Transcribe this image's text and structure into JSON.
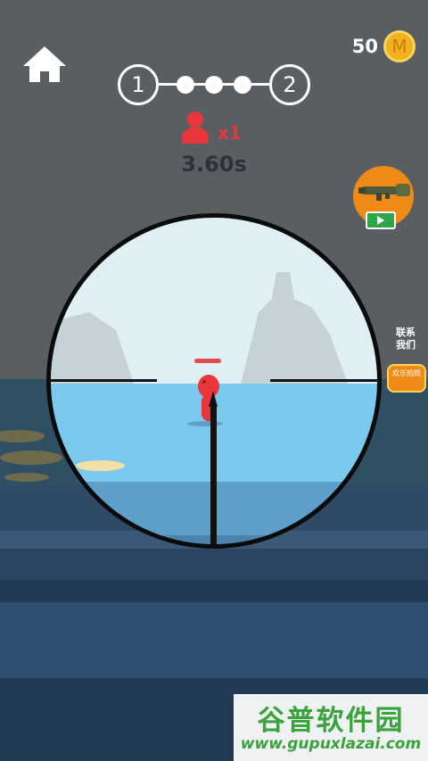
{
  "hud": {
    "coins": "50",
    "coin_symbol": "M",
    "stage_from": "1",
    "stage_to": "2",
    "enemy_multiplier": "x1",
    "timer": "3.60s"
  },
  "side": {
    "contact_label": "联系我们",
    "photo_label": "欢乐拍照"
  },
  "watermark": {
    "title": "谷普软件园",
    "url": "www.gupuxlazai.com"
  },
  "colors": {
    "enemy": "#e8363b",
    "coin": "#f0b31e",
    "weapon_button": "#f08a17",
    "water": "#7ac9ee",
    "sky_scope": "#dfeff4"
  },
  "icons": {
    "home": "home-icon",
    "coin": "coin-icon",
    "enemy": "person-icon",
    "weapon": "rocket-launcher-icon",
    "video": "video-play-icon"
  }
}
